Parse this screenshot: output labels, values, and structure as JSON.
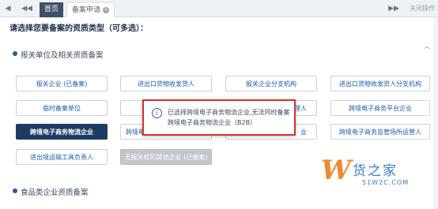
{
  "tabbar": {
    "home_label": "首页",
    "current_tab_label": "备案申请",
    "close_tab_glyph": "×",
    "close_ops_label": "关闭操作",
    "nav_left_glyph": "◀",
    "nav_prev_glyph": "◀◀",
    "nav_next_glyph": "▶▶",
    "nav_more_glyph": "▶"
  },
  "question": "请选择您要备案的资质类型（可多选）：",
  "scroll_chevron_glyph": "︿",
  "sections": [
    {
      "title": "报关单位及相关资质备案"
    },
    {
      "title": "食品类企业资质备案"
    }
  ],
  "options": [
    {
      "label": "报关企业 (已备案)",
      "state": "disabled"
    },
    {
      "label": "进出口货物收发货人",
      "state": "normal"
    },
    {
      "label": "报关企业分支机构",
      "state": "normal"
    },
    {
      "label": "进出口货物收发货人分支机构",
      "state": "normal"
    },
    {
      "label": "临时备案单位",
      "state": "normal"
    },
    {
      "label": "跨",
      "state": "normal"
    },
    {
      "label": "代理人",
      "state": "normal"
    },
    {
      "label": "跨境电子商务平台企业",
      "state": "normal"
    },
    {
      "label": "跨境电子商务物流企业",
      "state": "selected"
    },
    {
      "label": "跨境电",
      "state": "normal"
    },
    {
      "label": "业",
      "state": "normal"
    },
    {
      "label": "跨境电子商务监管场所运营人",
      "state": "normal"
    },
    {
      "label": "进出境运输工具负责人",
      "state": "normal"
    },
    {
      "label": "无报关权的其他企业 (已备案)",
      "state": "disabled"
    }
  ],
  "dialog": {
    "icon_glyph": "i",
    "message": "已选择跨境电子商务物流企业,无法同时备案跨境电子商务物流企业（B2B）"
  },
  "watermark": {
    "logo_glyph": "W",
    "brand": "货之家",
    "url": "51W2C.COM"
  },
  "colors": {
    "selected": "#1e3c63",
    "disabled": "#c3c7cc",
    "option_text": "#1f5aa8",
    "dialog_border": "#d9302a",
    "home_tab": "#3e5066"
  }
}
